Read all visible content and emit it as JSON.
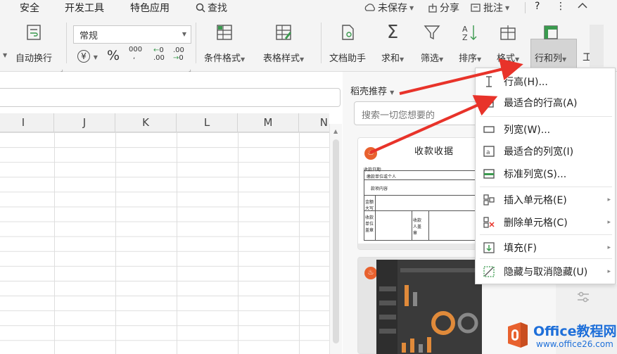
{
  "menubar": {
    "items": [
      "安全",
      "开发工具",
      "特色应用"
    ],
    "search": "查找",
    "unsaved": "未保存",
    "share": "分享",
    "comment": "批注",
    "help": "?",
    "more": "⋮",
    "collapse": "^"
  },
  "ribbon": {
    "wrap_text": "自动换行",
    "number_format": "常规",
    "percent": "%",
    "thousands": "000",
    "dec_inc": ".00",
    "dec_dec": ".00",
    "cond_format": "条件格式",
    "table_style": "表格样式",
    "doc_helper": "文档助手",
    "sum": "求和",
    "filter": "筛选",
    "sort": "排序",
    "format": "格式",
    "row_col": "行和列",
    "work": "工",
    "sum_symbol": "Σ",
    "yen": "¥"
  },
  "grid": {
    "columns": [
      "I",
      "J",
      "K",
      "L",
      "M",
      "N"
    ]
  },
  "panel": {
    "title": "稻壳推荐",
    "search_placeholder": "搜索一切您想要的",
    "card1_title": "收款收据",
    "receipt_rows": [
      "收款日期:",
      "缴款单位或个人",
      "款项内容",
      "金额大写",
      "收款单位盖章",
      "收款人盖章"
    ]
  },
  "dropdown": {
    "items": [
      {
        "label": "行高(H)...",
        "submenu": false
      },
      {
        "label": "最适合的行高(A)",
        "submenu": false
      },
      {
        "label": "列宽(W)...",
        "submenu": false
      },
      {
        "label": "最适合的列宽(I)",
        "submenu": false
      },
      {
        "label": "标准列宽(S)...",
        "submenu": false
      },
      {
        "label": "插入单元格(E)",
        "submenu": true
      },
      {
        "label": "删除单元格(C)",
        "submenu": true
      },
      {
        "label": "填充(F)",
        "submenu": true
      },
      {
        "label": "隐藏与取消隐藏(U)",
        "submenu": true
      }
    ]
  },
  "watermark": {
    "brand": "Office教程网",
    "url": "www.office26.com"
  },
  "colors": {
    "accent_red": "#e8332a",
    "brand_blue": "#1e6fd9",
    "office_orange": "#e8612e"
  }
}
